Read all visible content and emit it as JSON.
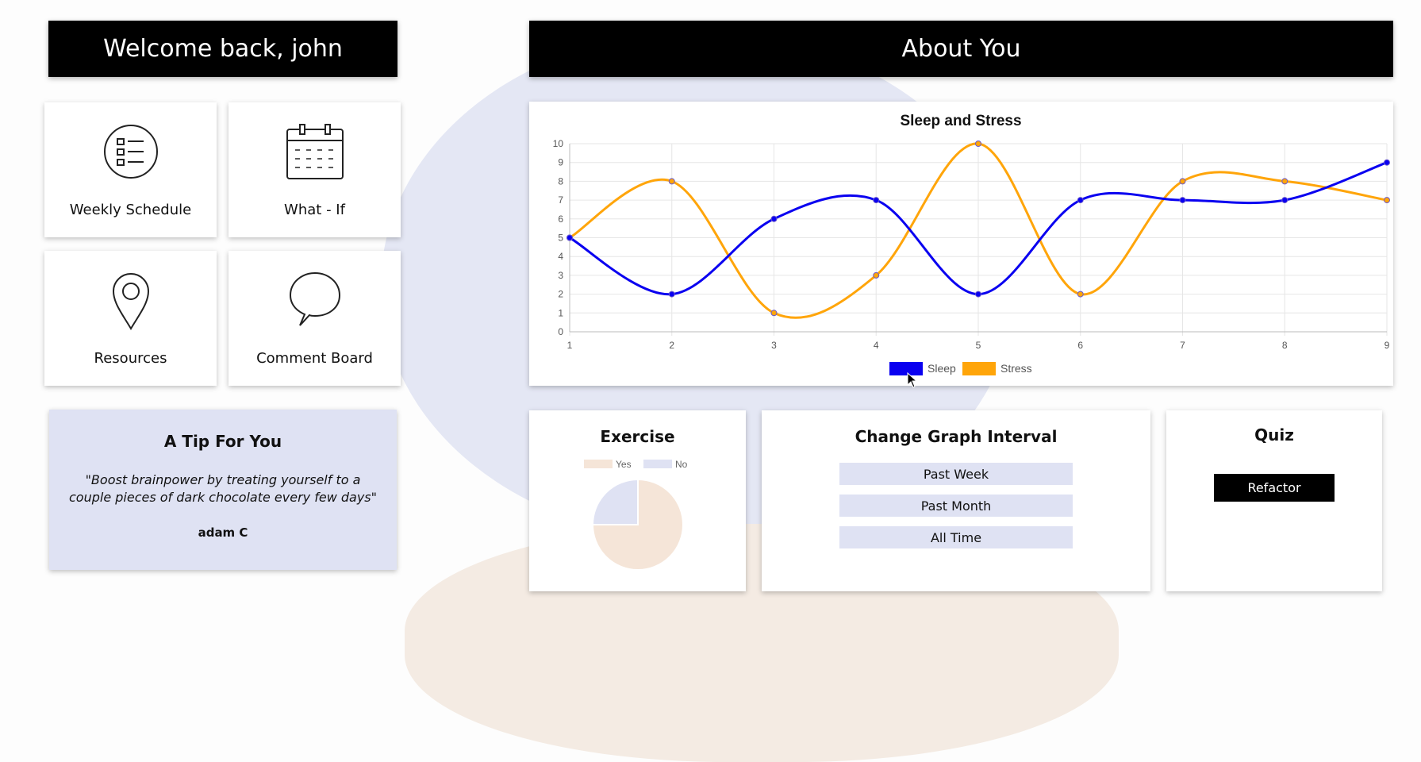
{
  "welcome": {
    "title": "Welcome back, john"
  },
  "about": {
    "title": "About You"
  },
  "tiles": [
    {
      "label": "Weekly Schedule",
      "icon": "list-icon"
    },
    {
      "label": "What - If",
      "icon": "calendar-icon"
    },
    {
      "label": "Resources",
      "icon": "location-pin-icon"
    },
    {
      "label": "Comment Board",
      "icon": "speech-bubble-icon"
    }
  ],
  "tip": {
    "title": "A Tip For You",
    "quote": "\"Boost brainpower by treating yourself to a couple pieces of dark chocolate every few days\"",
    "author": "adam C"
  },
  "exercise": {
    "title": "Exercise"
  },
  "interval": {
    "title": "Change Graph Interval",
    "options": [
      "Past Week",
      "Past Month",
      "All Time"
    ]
  },
  "quiz": {
    "title": "Quiz",
    "button": "Refactor"
  },
  "colors": {
    "sleep": "#0a00f0",
    "stress": "#ffa50a",
    "pie_yes": "#f5e5d8",
    "pie_no": "#dfe2f3",
    "header_bg": "#000000"
  },
  "chart_data": [
    {
      "type": "line",
      "title": "Sleep and Stress",
      "x": [
        1,
        2,
        3,
        4,
        5,
        6,
        7,
        8,
        9
      ],
      "ylim": [
        0,
        10
      ],
      "yticks": [
        0,
        1,
        2,
        3,
        4,
        5,
        6,
        7,
        8,
        9,
        10
      ],
      "grid": true,
      "legend": "bottom",
      "series": [
        {
          "name": "Sleep",
          "values": [
            5,
            2,
            6,
            7,
            2,
            7,
            7,
            7,
            9
          ]
        },
        {
          "name": "Stress",
          "values": [
            5,
            8,
            1,
            3,
            10,
            2,
            8,
            8,
            7
          ]
        }
      ]
    },
    {
      "type": "pie",
      "title": "Exercise",
      "labels": [
        "Yes",
        "No"
      ],
      "values": [
        75,
        25
      ],
      "legend": "top"
    }
  ]
}
